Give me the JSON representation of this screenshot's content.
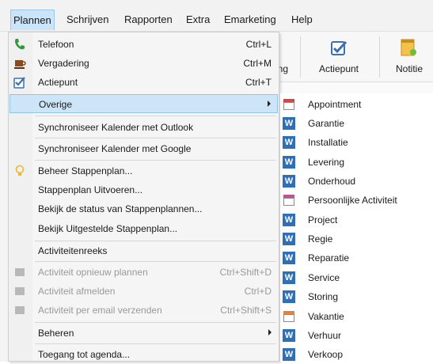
{
  "menubar": {
    "items": [
      "Plannen",
      "Schrijven",
      "Rapporten",
      "Extra",
      "Emarketing",
      "Help"
    ]
  },
  "toolbar": {
    "partial_label": "ing",
    "actiepunt": "Actiepunt",
    "notitie": "Notitie"
  },
  "menu": {
    "items": [
      {
        "label": "Telefoon",
        "shortcut": "Ctrl+L",
        "icon": "phone-icon"
      },
      {
        "label": "Vergadering",
        "shortcut": "Ctrl+M",
        "icon": "coffee-icon"
      },
      {
        "label": "Actiepunt",
        "shortcut": "Ctrl+T",
        "icon": "checkbox-icon"
      },
      {
        "label": "Overige",
        "icon": "submenu-arrow"
      },
      {
        "label": "Synchroniseer Kalender met Outlook"
      },
      {
        "label": "Synchroniseer Kalender met Google"
      },
      {
        "label": "Beheer Stappenplan...",
        "icon": "lightbulb-icon"
      },
      {
        "label": "Stappenplan Uitvoeren..."
      },
      {
        "label": "Bekijk de status van Stappenplannen..."
      },
      {
        "label": "Bekijk Uitgestelde Stappenplan..."
      },
      {
        "label": "Activiteitenreeks"
      },
      {
        "label": "Activiteit opnieuw plannen",
        "shortcut": "Ctrl+Shift+D",
        "disabled": true
      },
      {
        "label": "Activiteit afmelden",
        "shortcut": "Ctrl+D",
        "disabled": true
      },
      {
        "label": "Activiteit per email verzenden",
        "shortcut": "Ctrl+Shift+S",
        "disabled": true
      },
      {
        "label": "Beheren",
        "icon": "submenu-arrow"
      },
      {
        "label": "Toegang tot agenda..."
      }
    ]
  },
  "submenu": {
    "items": [
      {
        "label": "Appointment",
        "icon": "calendar-icon"
      },
      {
        "label": "Garantie",
        "icon": "w-icon"
      },
      {
        "label": "Installatie",
        "icon": "w-icon"
      },
      {
        "label": "Levering",
        "icon": "w-icon"
      },
      {
        "label": "Onderhoud",
        "icon": "w-icon"
      },
      {
        "label": "Persoonlijke Activiteit",
        "icon": "calendar-icon"
      },
      {
        "label": "Project",
        "icon": "w-icon"
      },
      {
        "label": "Regie",
        "icon": "w-icon"
      },
      {
        "label": "Reparatie",
        "icon": "w-icon"
      },
      {
        "label": "Service",
        "icon": "w-icon"
      },
      {
        "label": "Storing",
        "icon": "w-icon"
      },
      {
        "label": "Vakantie",
        "icon": "calendar-icon"
      },
      {
        "label": "Verhuur",
        "icon": "w-icon"
      },
      {
        "label": "Verkoop",
        "icon": "w-icon"
      }
    ]
  },
  "colors": {
    "highlight": "#cde6f7",
    "highlight_border": "#8fc5ea",
    "word_blue": "#2f6fb5",
    "disabled_text": "#9a9a9a"
  }
}
